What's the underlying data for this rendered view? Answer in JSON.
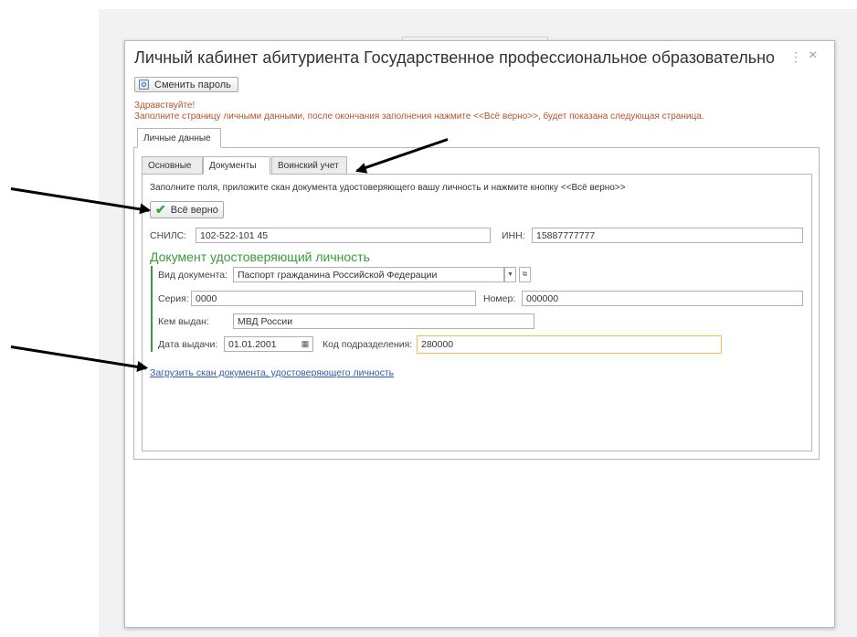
{
  "window": {
    "title": "Личный кабинет абитуриента Государственное профессиональное образовательное автономное уч...",
    "more_icon": "⋮",
    "close_icon": "×"
  },
  "toolbar": {
    "change_password_label": "Сменить пароль"
  },
  "messages": {
    "greeting": "Здравствуйте!",
    "instruction": "Заполните страницу личными данными, после окончания заполнения нажмите <<Всё верно>>, будет показана следующая страница."
  },
  "outer_tab": {
    "label": "Личные данные"
  },
  "inner_tabs": [
    {
      "label": "Основные"
    },
    {
      "label": "Документы"
    },
    {
      "label": "Воинский учет"
    }
  ],
  "documents": {
    "instruction": "Заполните поля, приложите скан документа удостоверяющего вашу личность и нажмите кнопку <<Всё верно>>",
    "ok_button": "Всё верно",
    "snils_label": "СНИЛС:",
    "snils_value": "102-522-101 45",
    "inn_label": "ИНН:",
    "inn_value": "15887777777",
    "section_title": "Документ удостоверяющий личность",
    "doc_type_label": "Вид документа:",
    "doc_type_value": "Паспорт гражданина Российской Федерации",
    "series_label": "Серия:",
    "series_value": "0000",
    "number_label": "Номер:",
    "number_value": "000000",
    "issued_by_label": "Кем выдан:",
    "issued_by_value": "МВД России",
    "issue_date_label": "Дата выдачи:",
    "issue_date_value": "01.01.2001",
    "dept_code_label": "Код подразделения:",
    "dept_code_value": "280000",
    "upload_link": "Загрузить скан документа, удостоверяющего личность"
  },
  "colors": {
    "accent_green": "#3a9a3a",
    "message_orange": "#b5542b",
    "link_blue": "#2e5bb3",
    "focus_border": "#f0c040"
  }
}
